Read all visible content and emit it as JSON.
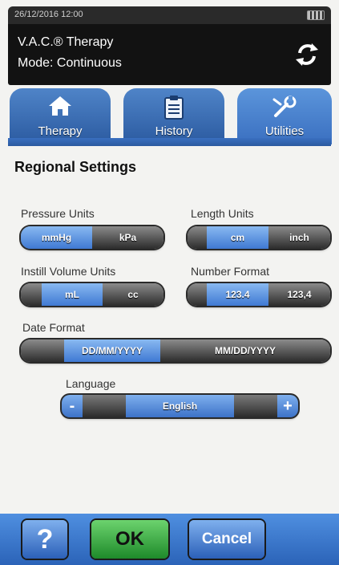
{
  "status": {
    "datetime": "26/12/2016 12:00"
  },
  "header": {
    "title": "V.A.C.® Therapy",
    "mode": "Mode: Continuous"
  },
  "tabs": [
    {
      "label": "Therapy",
      "icon": "home-icon"
    },
    {
      "label": "History",
      "icon": "clipboard-icon"
    },
    {
      "label": "Utilities",
      "icon": "wrench-icon",
      "active": true
    }
  ],
  "page": {
    "title": "Regional Settings"
  },
  "settings": {
    "pressure_units": {
      "label": "Pressure Units",
      "options": [
        "mmHg",
        "kPa"
      ],
      "selected": "mmHg"
    },
    "length_units": {
      "label": "Length Units",
      "options": [
        "cm",
        "inch"
      ],
      "selected": "cm"
    },
    "instill_volume_units": {
      "label": "Instill Volume Units",
      "options": [
        "mL",
        "cc"
      ],
      "selected": "mL"
    },
    "number_format": {
      "label": "Number Format",
      "options": [
        "123.4",
        "123,4"
      ],
      "selected": "123.4"
    },
    "date_format": {
      "label": "Date Format",
      "options": [
        "DD/MM/YYYY",
        "MM/DD/YYYY"
      ],
      "selected": "DD/MM/YYYY"
    },
    "language": {
      "label": "Language",
      "value": "English",
      "decrease": "-",
      "increase": "+"
    }
  },
  "footer": {
    "help": "?",
    "ok": "OK",
    "cancel": "Cancel"
  },
  "colors": {
    "accent_blue": "#3f79d3",
    "ok_green": "#2fa83a",
    "header_black": "#121212"
  }
}
